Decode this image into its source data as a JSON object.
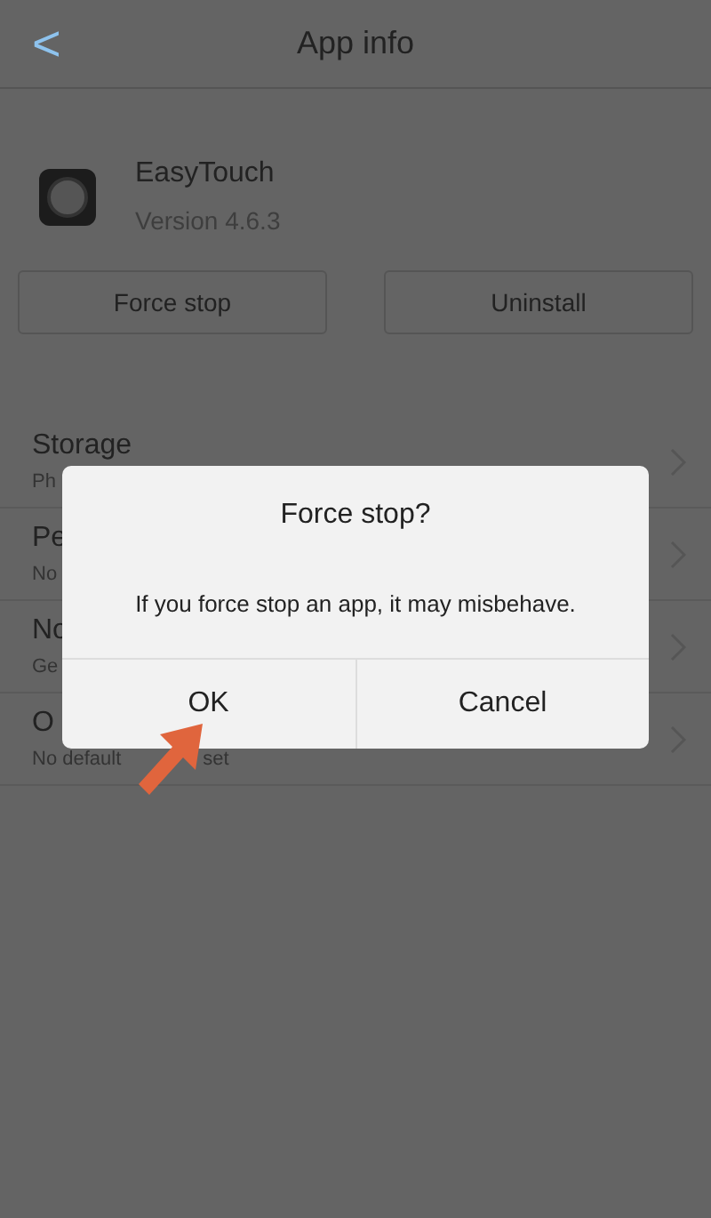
{
  "header": {
    "back": "<",
    "title": "App info"
  },
  "app": {
    "name": "EasyTouch",
    "version": "Version 4.6.3"
  },
  "actions": [
    "Force stop",
    "Uninstall"
  ],
  "rows": [
    {
      "title": "Storage",
      "subtitle": "Ph"
    },
    {
      "title": "Pe",
      "subtitle": "No"
    },
    {
      "title": "No",
      "subtitle": "Ge"
    },
    {
      "title": "O",
      "subtitle": "No default",
      "subtitle_tail": "set"
    }
  ],
  "dialog": {
    "title": "Force stop?",
    "message": "If you force stop an app, it may misbehave.",
    "buttons": [
      "OK",
      "Cancel"
    ]
  }
}
